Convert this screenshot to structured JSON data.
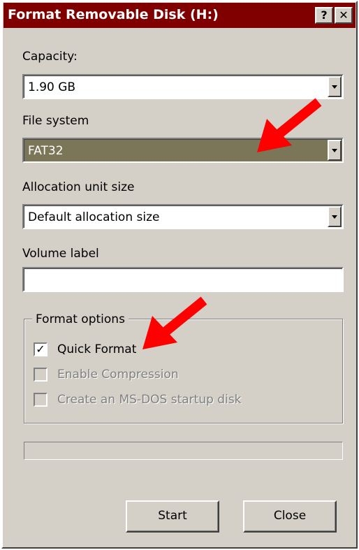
{
  "window": {
    "title": "Format Removable Disk (H:)",
    "help_label": "?",
    "close_label": "✕"
  },
  "capacity": {
    "label": "Capacity:",
    "value": "1.90 GB"
  },
  "file_system": {
    "label": "File system",
    "value": "FAT32"
  },
  "allocation": {
    "label": "Allocation unit size",
    "value": "Default allocation size"
  },
  "volume_label": {
    "label": "Volume label",
    "value": ""
  },
  "format_options": {
    "title": "Format options",
    "quick_format": {
      "label": "Quick Format",
      "checked": true,
      "enabled": true
    },
    "enable_compression": {
      "label": "Enable Compression",
      "checked": false,
      "enabled": false
    },
    "msdos_startup": {
      "label": "Create an MS-DOS startup disk",
      "checked": false,
      "enabled": false
    }
  },
  "buttons": {
    "start": "Start",
    "close": "Close"
  },
  "colors": {
    "titlebar": "#800000",
    "dialog_bg": "#d4d0c8",
    "selection": "#7b7658",
    "annotation_arrow": "#ff0000"
  },
  "icons": {
    "help": "question-mark-icon",
    "close": "close-icon",
    "dropdown": "chevron-down-icon",
    "check": "checkmark-icon",
    "annotation": "red-arrow-icon"
  }
}
